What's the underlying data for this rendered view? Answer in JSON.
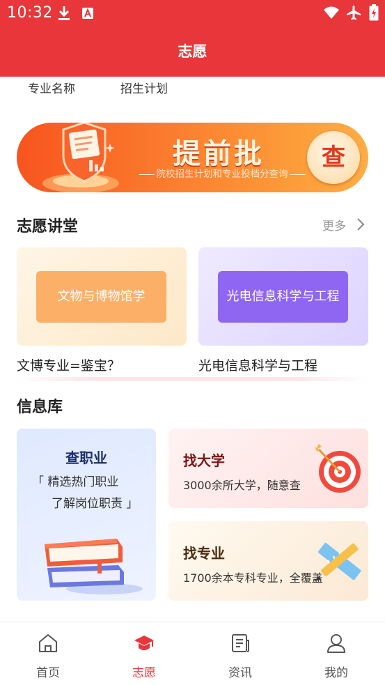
{
  "status_bar": {
    "time": "10:32"
  },
  "header": {
    "title": "志愿"
  },
  "subtabs": [
    "专业名称",
    "招生计划"
  ],
  "banner": {
    "title": "提前批",
    "subtitle": "院校招生计划和专业投档分查询",
    "button_label": "查"
  },
  "lecture_section": {
    "title": "志愿讲堂",
    "more_label": "更多",
    "cards": [
      {
        "pill": "文物与博物馆学",
        "caption": "文博专业=鉴宝？"
      },
      {
        "pill": "光电信息科学与工程",
        "caption": "光电信息科学与工程"
      }
    ]
  },
  "info_section": {
    "title": "信息库",
    "job_card": {
      "title": "查职业",
      "line1": "「 精选热门职业",
      "line2": "了解岗位职责 」"
    },
    "university_card": {
      "title": "找大学",
      "desc": "3000余所大学，随意查"
    },
    "major_card": {
      "title": "找专业",
      "desc": "1700余本专科专业，全覆盖"
    }
  },
  "bottom_nav": {
    "active_index": 1,
    "items": [
      {
        "label": "首页",
        "icon": "home-icon"
      },
      {
        "label": "志愿",
        "icon": "graduation-cap-icon"
      },
      {
        "label": "资讯",
        "icon": "news-icon"
      },
      {
        "label": "我的",
        "icon": "profile-icon"
      }
    ]
  },
  "colors": {
    "brand_red": "#e8363a",
    "banner_orange": "#f8541f",
    "purple": "#8f66f2",
    "peach": "#fcb067"
  }
}
